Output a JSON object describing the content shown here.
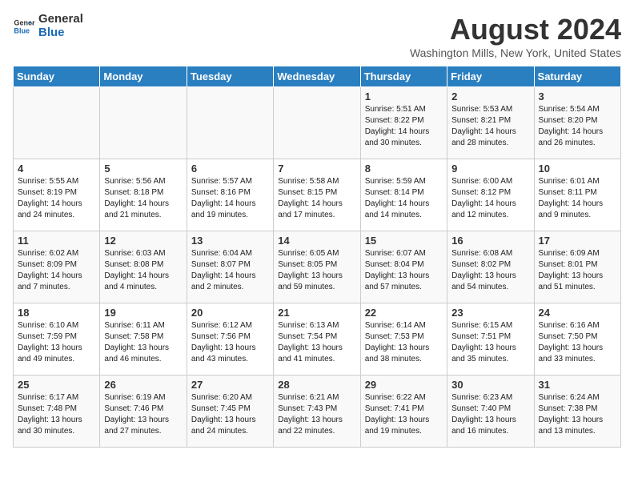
{
  "header": {
    "logo_line1": "General",
    "logo_line2": "Blue",
    "month": "August 2024",
    "location": "Washington Mills, New York, United States"
  },
  "weekdays": [
    "Sunday",
    "Monday",
    "Tuesday",
    "Wednesday",
    "Thursday",
    "Friday",
    "Saturday"
  ],
  "weeks": [
    [
      {
        "day": "",
        "info": ""
      },
      {
        "day": "",
        "info": ""
      },
      {
        "day": "",
        "info": ""
      },
      {
        "day": "",
        "info": ""
      },
      {
        "day": "1",
        "info": "Sunrise: 5:51 AM\nSunset: 8:22 PM\nDaylight: 14 hours\nand 30 minutes."
      },
      {
        "day": "2",
        "info": "Sunrise: 5:53 AM\nSunset: 8:21 PM\nDaylight: 14 hours\nand 28 minutes."
      },
      {
        "day": "3",
        "info": "Sunrise: 5:54 AM\nSunset: 8:20 PM\nDaylight: 14 hours\nand 26 minutes."
      }
    ],
    [
      {
        "day": "4",
        "info": "Sunrise: 5:55 AM\nSunset: 8:19 PM\nDaylight: 14 hours\nand 24 minutes."
      },
      {
        "day": "5",
        "info": "Sunrise: 5:56 AM\nSunset: 8:18 PM\nDaylight: 14 hours\nand 21 minutes."
      },
      {
        "day": "6",
        "info": "Sunrise: 5:57 AM\nSunset: 8:16 PM\nDaylight: 14 hours\nand 19 minutes."
      },
      {
        "day": "7",
        "info": "Sunrise: 5:58 AM\nSunset: 8:15 PM\nDaylight: 14 hours\nand 17 minutes."
      },
      {
        "day": "8",
        "info": "Sunrise: 5:59 AM\nSunset: 8:14 PM\nDaylight: 14 hours\nand 14 minutes."
      },
      {
        "day": "9",
        "info": "Sunrise: 6:00 AM\nSunset: 8:12 PM\nDaylight: 14 hours\nand 12 minutes."
      },
      {
        "day": "10",
        "info": "Sunrise: 6:01 AM\nSunset: 8:11 PM\nDaylight: 14 hours\nand 9 minutes."
      }
    ],
    [
      {
        "day": "11",
        "info": "Sunrise: 6:02 AM\nSunset: 8:09 PM\nDaylight: 14 hours\nand 7 minutes."
      },
      {
        "day": "12",
        "info": "Sunrise: 6:03 AM\nSunset: 8:08 PM\nDaylight: 14 hours\nand 4 minutes."
      },
      {
        "day": "13",
        "info": "Sunrise: 6:04 AM\nSunset: 8:07 PM\nDaylight: 14 hours\nand 2 minutes."
      },
      {
        "day": "14",
        "info": "Sunrise: 6:05 AM\nSunset: 8:05 PM\nDaylight: 13 hours\nand 59 minutes."
      },
      {
        "day": "15",
        "info": "Sunrise: 6:07 AM\nSunset: 8:04 PM\nDaylight: 13 hours\nand 57 minutes."
      },
      {
        "day": "16",
        "info": "Sunrise: 6:08 AM\nSunset: 8:02 PM\nDaylight: 13 hours\nand 54 minutes."
      },
      {
        "day": "17",
        "info": "Sunrise: 6:09 AM\nSunset: 8:01 PM\nDaylight: 13 hours\nand 51 minutes."
      }
    ],
    [
      {
        "day": "18",
        "info": "Sunrise: 6:10 AM\nSunset: 7:59 PM\nDaylight: 13 hours\nand 49 minutes."
      },
      {
        "day": "19",
        "info": "Sunrise: 6:11 AM\nSunset: 7:58 PM\nDaylight: 13 hours\nand 46 minutes."
      },
      {
        "day": "20",
        "info": "Sunrise: 6:12 AM\nSunset: 7:56 PM\nDaylight: 13 hours\nand 43 minutes."
      },
      {
        "day": "21",
        "info": "Sunrise: 6:13 AM\nSunset: 7:54 PM\nDaylight: 13 hours\nand 41 minutes."
      },
      {
        "day": "22",
        "info": "Sunrise: 6:14 AM\nSunset: 7:53 PM\nDaylight: 13 hours\nand 38 minutes."
      },
      {
        "day": "23",
        "info": "Sunrise: 6:15 AM\nSunset: 7:51 PM\nDaylight: 13 hours\nand 35 minutes."
      },
      {
        "day": "24",
        "info": "Sunrise: 6:16 AM\nSunset: 7:50 PM\nDaylight: 13 hours\nand 33 minutes."
      }
    ],
    [
      {
        "day": "25",
        "info": "Sunrise: 6:17 AM\nSunset: 7:48 PM\nDaylight: 13 hours\nand 30 minutes."
      },
      {
        "day": "26",
        "info": "Sunrise: 6:19 AM\nSunset: 7:46 PM\nDaylight: 13 hours\nand 27 minutes."
      },
      {
        "day": "27",
        "info": "Sunrise: 6:20 AM\nSunset: 7:45 PM\nDaylight: 13 hours\nand 24 minutes."
      },
      {
        "day": "28",
        "info": "Sunrise: 6:21 AM\nSunset: 7:43 PM\nDaylight: 13 hours\nand 22 minutes."
      },
      {
        "day": "29",
        "info": "Sunrise: 6:22 AM\nSunset: 7:41 PM\nDaylight: 13 hours\nand 19 minutes."
      },
      {
        "day": "30",
        "info": "Sunrise: 6:23 AM\nSunset: 7:40 PM\nDaylight: 13 hours\nand 16 minutes."
      },
      {
        "day": "31",
        "info": "Sunrise: 6:24 AM\nSunset: 7:38 PM\nDaylight: 13 hours\nand 13 minutes."
      }
    ]
  ]
}
